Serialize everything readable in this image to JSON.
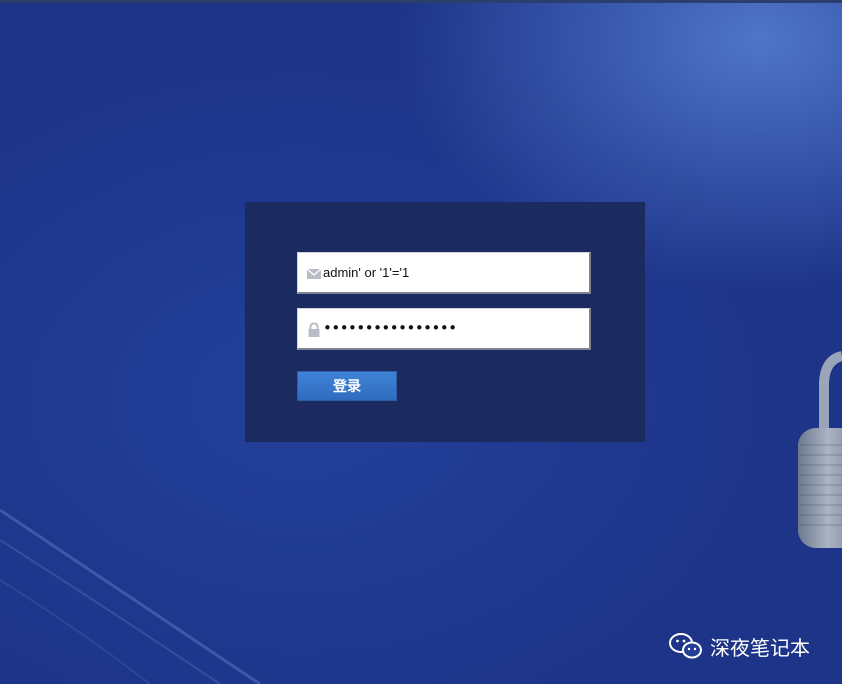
{
  "login_form": {
    "username_value": "admin' or '1'='1",
    "password_value": "••••••••••••••••",
    "submit_label": "登录"
  },
  "watermark": {
    "text": "深夜笔记本",
    "icon": "wechat-icon"
  },
  "icons": {
    "username_icon": "envelope-icon",
    "password_icon": "lock-icon"
  },
  "colors": {
    "background": "#1f3a90",
    "panel": "#1b2b60",
    "button": "#3478cc"
  }
}
